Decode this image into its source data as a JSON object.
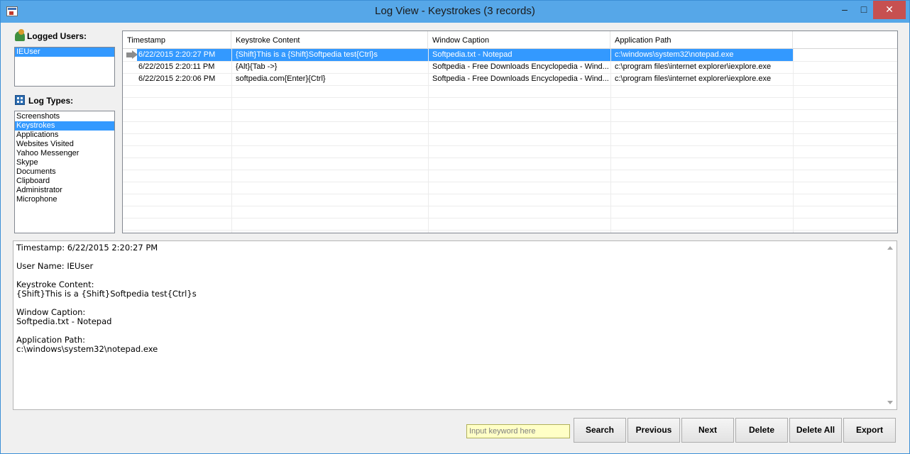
{
  "window": {
    "title": "Log View - Keystrokes (3 records)",
    "min_glyph": "–",
    "max_glyph": "□",
    "close_glyph": "✕"
  },
  "sidebar": {
    "users_label": "Logged Users:",
    "users": [
      {
        "label": "IEUser",
        "selected": true
      }
    ],
    "types_label": "Log Types:",
    "log_types": [
      {
        "label": "Screenshots",
        "selected": false
      },
      {
        "label": "Keystrokes",
        "selected": true
      },
      {
        "label": "Applications",
        "selected": false
      },
      {
        "label": "Websites Visited",
        "selected": false
      },
      {
        "label": "Yahoo Messenger",
        "selected": false
      },
      {
        "label": "Skype",
        "selected": false
      },
      {
        "label": "Documents",
        "selected": false
      },
      {
        "label": "Clipboard",
        "selected": false
      },
      {
        "label": "Administrator",
        "selected": false
      },
      {
        "label": "Microphone",
        "selected": false
      }
    ]
  },
  "grid": {
    "columns": [
      "Timestamp",
      "Keystroke Content",
      "Window Caption",
      "Application Path"
    ],
    "rows": [
      {
        "cells": [
          "6/22/2015 2:20:27 PM",
          "{Shift}This is a {Shift}Softpedia test{Ctrl}s",
          "Softpedia.txt - Notepad",
          "c:\\windows\\system32\\notepad.exe"
        ],
        "selected": true
      },
      {
        "cells": [
          "6/22/2015 2:20:11 PM",
          "{Alt}{Tab ->}",
          "Softpedia - Free Downloads Encyclopedia - Wind...",
          "c:\\program files\\internet explorer\\iexplore.exe"
        ],
        "selected": false
      },
      {
        "cells": [
          "6/22/2015 2:20:06 PM",
          "softpedia.com{Enter}{Ctrl}",
          "Softpedia - Free Downloads Encyclopedia - Wind...",
          "c:\\program files\\internet explorer\\iexplore.exe"
        ],
        "selected": false
      }
    ]
  },
  "details": {
    "lines": [
      "Timestamp: 6/22/2015 2:20:27 PM",
      "",
      "User Name: IEUser",
      "",
      "Keystroke Content:",
      "{Shift}This is a {Shift}Softpedia test{Ctrl}s",
      "",
      "Window Caption:",
      "Softpedia.txt - Notepad",
      "",
      "Application Path:",
      "c:\\windows\\system32\\notepad.exe"
    ]
  },
  "toolbar": {
    "search_placeholder": "Input keyword here",
    "search_value": "",
    "buttons": [
      "Search",
      "Previous",
      "Next",
      "Delete",
      "Delete All",
      "Export"
    ]
  },
  "colors": {
    "titlebar": "#56a7e8",
    "selection": "#3399ff",
    "search_bg": "#ffffc6"
  },
  "icons": {
    "app": "app-icon",
    "users": "users-icon",
    "types": "log-types-icon",
    "row_pointer": "arrow-right-icon"
  }
}
